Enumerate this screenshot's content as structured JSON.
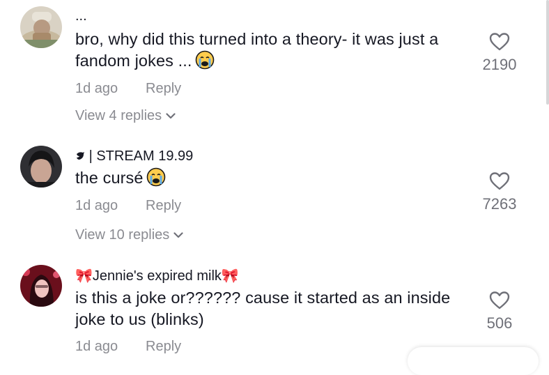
{
  "comments": [
    {
      "username": "...",
      "text": "bro, why did this turned into a theory- it was just a fandom jokes ...",
      "emoji": "crying-face-emoji",
      "time": "1d ago",
      "reply_label": "Reply",
      "likes": "2190",
      "view_replies": "View 4 replies"
    },
    {
      "username": "| STREAM 19.99",
      "username_prefix_icon": "bird-icon",
      "text": "the cursé",
      "emoji": "crying-face-emoji",
      "time": "1d ago",
      "reply_label": "Reply",
      "likes": "7263",
      "view_replies": "View 10 replies"
    },
    {
      "username": "🎀Jennie's expired milk🎀",
      "text": "is this a joke or?????? cause it started as an inside joke to us (blinks)",
      "time": "1d ago",
      "reply_label": "Reply",
      "likes": "506"
    }
  ],
  "colors": {
    "text": "#161823",
    "muted": "#8a8b91",
    "heart_outline": "#6f7078"
  }
}
